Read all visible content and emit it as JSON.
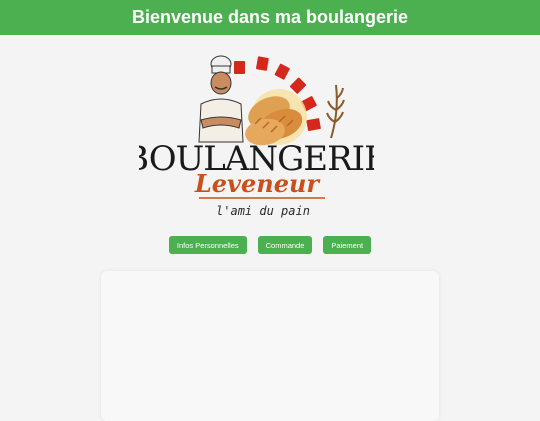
{
  "header": {
    "title": "Bienvenue dans ma boulangerie"
  },
  "logo": {
    "brand": "BOULANGERIE",
    "name": "Leveneur",
    "tagline": "l'ami du pain"
  },
  "nav": {
    "items": [
      {
        "label": "Infos Personnelles"
      },
      {
        "label": "Commande"
      },
      {
        "label": "Paiement"
      }
    ]
  },
  "colors": {
    "header_bg": "#4caf50",
    "button_bg": "#4caf50",
    "logo_accent": "#c8501c",
    "logo_red": "#d6271d"
  }
}
